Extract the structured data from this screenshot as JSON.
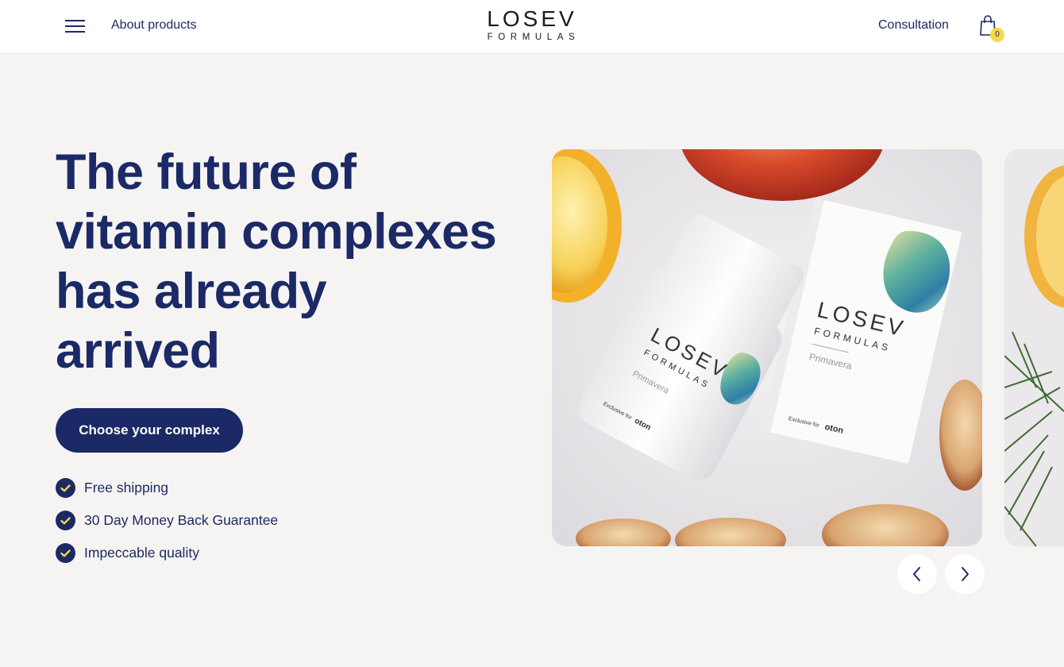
{
  "header": {
    "nav_about": "About products",
    "logo_main": "LOSEV",
    "logo_sub": "FORMULAS",
    "nav_consultation": "Consultation",
    "cart_count": "0"
  },
  "hero": {
    "headline": "The future of vitamin complexes has already arrived",
    "cta_label": "Choose your complex",
    "features": [
      "Free shipping",
      "30 Day Money Back Guarantee",
      "Impeccable quality"
    ]
  },
  "carousel": {
    "product_brand": "LOSEV",
    "product_line": "FORMULAS",
    "product_name": "Primavera",
    "exclusive_label": "Exclusive for",
    "partner": "oton"
  },
  "colors": {
    "brand_navy": "#1b2a66",
    "accent_yellow": "#f7d84a",
    "background": "#f6f4f2"
  },
  "icons": {
    "menu": "hamburger-icon",
    "cart": "shopping-bag-icon",
    "check": "check-circle-icon",
    "prev": "chevron-left-icon",
    "next": "chevron-right-icon"
  }
}
